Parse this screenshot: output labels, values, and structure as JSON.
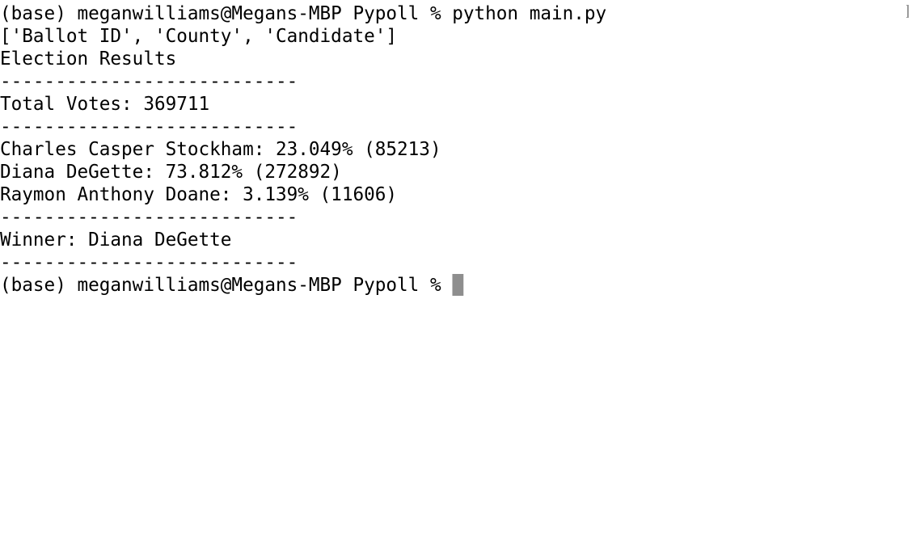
{
  "terminal": {
    "lines": [
      "(base) meganwilliams@Megans-MBP Pypoll % python main.py",
      "['Ballot ID', 'County', 'Candidate']",
      "Election Results",
      "---------------------------",
      "Total Votes: 369711",
      "---------------------------",
      "Charles Casper Stockham: 23.049% (85213)",
      "Diana DeGette: 73.812% (272892)",
      "Raymon Anthony Doane: 3.139% (11606)",
      "---------------------------",
      "Winner: Diana DeGette",
      "---------------------------"
    ],
    "prompt": "(base) meganwilliams@Megans-MBP Pypoll % ",
    "colors": {
      "background": "#ffffff",
      "text": "#000000",
      "cursor": "#8e8e8e"
    }
  }
}
